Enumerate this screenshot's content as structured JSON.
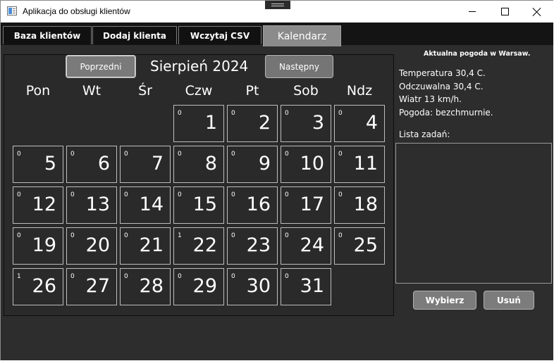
{
  "window": {
    "title": "Aplikacja do obsługi klientów"
  },
  "tabs": [
    {
      "label": "Baza klientów"
    },
    {
      "label": "Dodaj klienta"
    },
    {
      "label": "Wczytaj CSV"
    },
    {
      "label": "Kalendarz",
      "selected": true
    }
  ],
  "calendar": {
    "prev_label": "Poprzedni",
    "next_label": "Następny",
    "month_title": "Sierpień 2024",
    "weekdays": [
      "Pon",
      "Wt",
      "Śr",
      "Czw",
      "Pt",
      "Sob",
      "Ndz"
    ],
    "first_weekday_index": 3,
    "days": [
      {
        "day": "1",
        "count": "0"
      },
      {
        "day": "2",
        "count": "0"
      },
      {
        "day": "3",
        "count": "0"
      },
      {
        "day": "4",
        "count": "0"
      },
      {
        "day": "5",
        "count": "0"
      },
      {
        "day": "6",
        "count": "0"
      },
      {
        "day": "7",
        "count": "0"
      },
      {
        "day": "8",
        "count": "0"
      },
      {
        "day": "9",
        "count": "0"
      },
      {
        "day": "10",
        "count": "0"
      },
      {
        "day": "11",
        "count": "0"
      },
      {
        "day": "12",
        "count": "0"
      },
      {
        "day": "13",
        "count": "0"
      },
      {
        "day": "14",
        "count": "0"
      },
      {
        "day": "15",
        "count": "0"
      },
      {
        "day": "16",
        "count": "0"
      },
      {
        "day": "17",
        "count": "0"
      },
      {
        "day": "18",
        "count": "0"
      },
      {
        "day": "19",
        "count": "0"
      },
      {
        "day": "20",
        "count": "0"
      },
      {
        "day": "21",
        "count": "0"
      },
      {
        "day": "22",
        "count": "1"
      },
      {
        "day": "23",
        "count": "0"
      },
      {
        "day": "24",
        "count": "0"
      },
      {
        "day": "25",
        "count": "0"
      },
      {
        "day": "26",
        "count": "1"
      },
      {
        "day": "27",
        "count": "0"
      },
      {
        "day": "28",
        "count": "0"
      },
      {
        "day": "29",
        "count": "0"
      },
      {
        "day": "30",
        "count": "0"
      },
      {
        "day": "31",
        "count": "0"
      }
    ]
  },
  "weather": {
    "title": "Aktualna pogoda w Warsaw.",
    "lines": [
      "Temperatura 30,4 C.",
      "Odczuwalna 30,4 C.",
      "Wiatr 13 km/h.",
      "Pogoda: bezchmurnie."
    ]
  },
  "tasks": {
    "label": "Lista zadań:",
    "items": [],
    "select_label": "Wybierz",
    "delete_label": "Usuń"
  },
  "colors": {
    "background": "#2d2d2d",
    "tabstrip": "#141414",
    "active_tab": "#8b8b8b",
    "button": "#7a7a7a"
  }
}
